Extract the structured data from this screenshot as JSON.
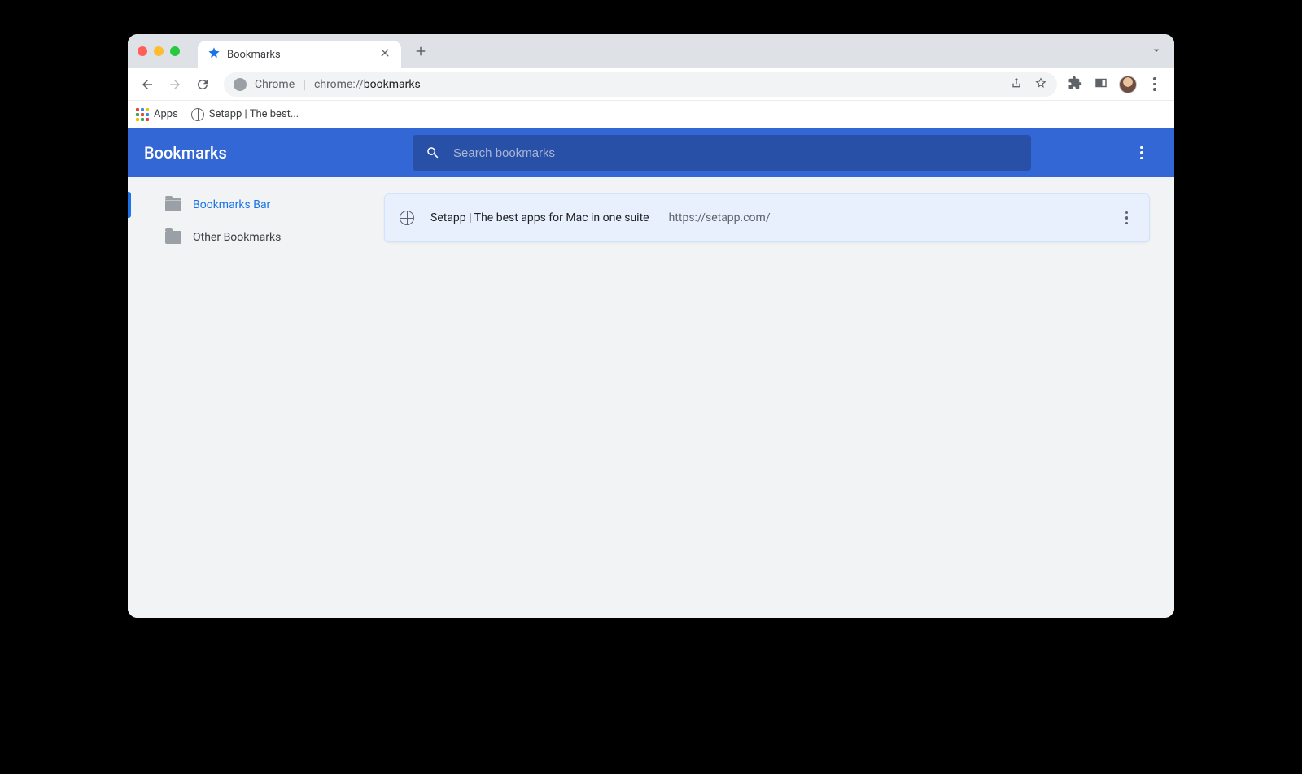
{
  "tab": {
    "title": "Bookmarks"
  },
  "omnibox": {
    "app_label": "Chrome",
    "scheme": "chrome://",
    "path": "bookmarks"
  },
  "bookmarks_bar": {
    "apps_label": "Apps",
    "items": [
      {
        "label": "Setapp | The best..."
      }
    ]
  },
  "app": {
    "title": "Bookmarks",
    "search_placeholder": "Search bookmarks"
  },
  "sidebar": {
    "folders": [
      {
        "label": "Bookmarks Bar",
        "active": true
      },
      {
        "label": "Other Bookmarks",
        "active": false
      }
    ]
  },
  "bookmarks": [
    {
      "title": "Setapp | The best apps for Mac in one suite",
      "url": "https://setapp.com/"
    }
  ]
}
